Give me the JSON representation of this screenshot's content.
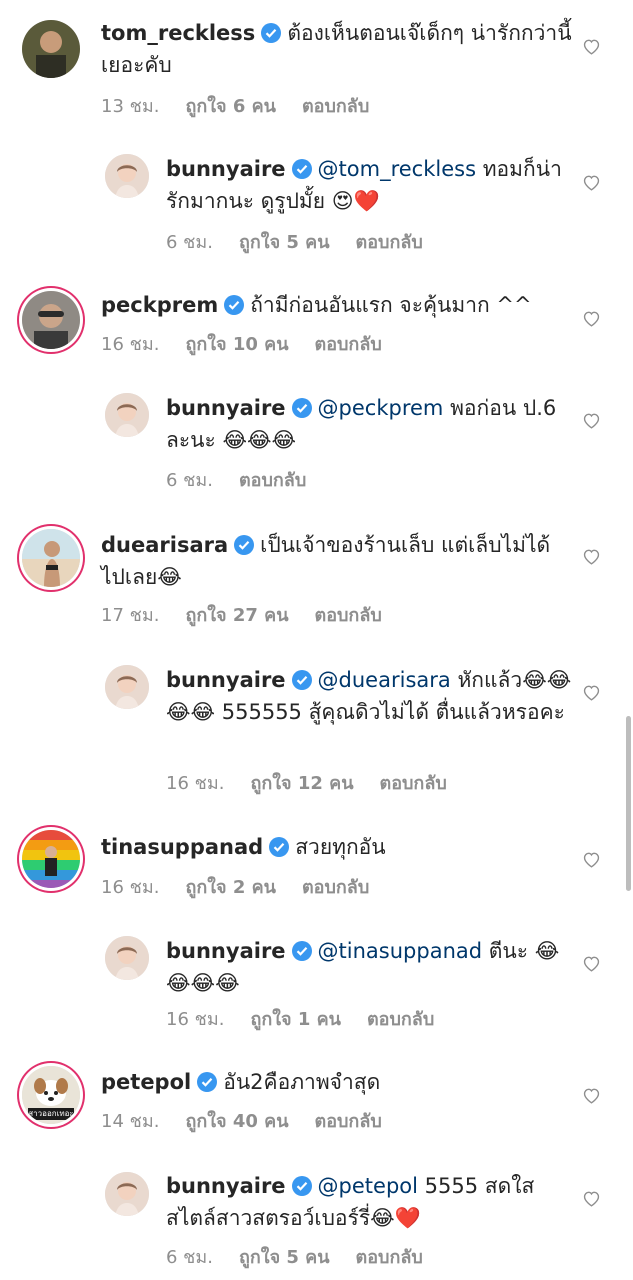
{
  "comments": [
    {
      "kind": "top",
      "username": "tom_reckless",
      "mention": "",
      "text": "ต้องเห็นตอนเจ๊เด็กๆ น่ารักกว่านี้เยอะคับ",
      "time": "13 ชม.",
      "likes": "ถูกใจ 6 คน",
      "reply": "ตอบกลับ",
      "avatar": "tom-avatar"
    },
    {
      "kind": "reply",
      "username": "bunnyaire",
      "mention": "@tom_reckless",
      "text": " ทอมก็น่ารักมากนะ ดูรูปมั้ย 😍❤️",
      "time": "6 ชม.",
      "likes": "ถูกใจ 5 คน",
      "reply": "ตอบกลับ",
      "avatar": "bunnyaire-avatar"
    },
    {
      "kind": "top",
      "username": "peckprem",
      "mention": "",
      "text": "ถ้ามีก่อนอันแรก จะคุ้นมาก ^^",
      "time": "16 ชม.",
      "likes": "ถูกใจ 10 คน",
      "reply": "ตอบกลับ",
      "avatar": "peckprem-avatar"
    },
    {
      "kind": "reply",
      "username": "bunnyaire",
      "mention": "@peckprem",
      "text": " พอก่อน ป.6 ละนะ 😂😂😂",
      "time": "6 ชม.",
      "likes": "",
      "reply": "ตอบกลับ",
      "avatar": "bunnyaire-avatar"
    },
    {
      "kind": "top",
      "username": "duearisara",
      "mention": "",
      "text": "เป็นเจ้าของร้านเล็บ แต่เล็บไม่ได้ไปเลย😂",
      "time": "17 ชม.",
      "likes": "ถูกใจ 27 คน",
      "reply": "ตอบกลับ",
      "avatar": "duearisara-avatar"
    },
    {
      "kind": "reply",
      "username": "bunnyaire",
      "mention": "@duearisara",
      "text": " หักแล้ว😂😂😂😂 555555 สู้คุณดิวไม่ได้ ตื่นแล้วหรอคะ",
      "time": "16 ชม.",
      "likes": "ถูกใจ 12 คน",
      "reply": "ตอบกลับ",
      "avatar": "bunnyaire-avatar"
    },
    {
      "kind": "top",
      "username": "tinasuppanad",
      "mention": "",
      "text": "สวยทุกอัน",
      "time": "16 ชม.",
      "likes": "ถูกใจ 2 คน",
      "reply": "ตอบกลับ",
      "avatar": "tinasuppanad-avatar"
    },
    {
      "kind": "reply",
      "username": "bunnyaire",
      "mention": "@tinasuppanad",
      "text": " ตีนะ 😂😂😂😂",
      "time": "16 ชม.",
      "likes": "ถูกใจ 1 คน",
      "reply": "ตอบกลับ",
      "avatar": "bunnyaire-avatar"
    },
    {
      "kind": "top",
      "username": "petepol",
      "mention": "",
      "text": "อัน2คือภาพจำสุด",
      "time": "14 ชม.",
      "likes": "ถูกใจ 40 คน",
      "reply": "ตอบกลับ",
      "avatar": "petepol-avatar",
      "avatar_caption": "สาวออกเทอะ"
    },
    {
      "kind": "reply",
      "username": "bunnyaire",
      "mention": "@petepol",
      "text": " 5555 สดใสสไตล์สาวสตรอว์เบอร์รี่😂❤️",
      "time": "6 ชม.",
      "likes": "ถูกใจ 5 คน",
      "reply": "ตอบกลับ",
      "avatar": "bunnyaire-avatar"
    }
  ],
  "colors": {
    "verified": "#3897f0",
    "mention": "#00376b",
    "meta": "#8e8e8e",
    "ring": "#e1306c"
  },
  "icons": {
    "verified": "verified-badge-icon",
    "like": "heart-outline-icon"
  }
}
